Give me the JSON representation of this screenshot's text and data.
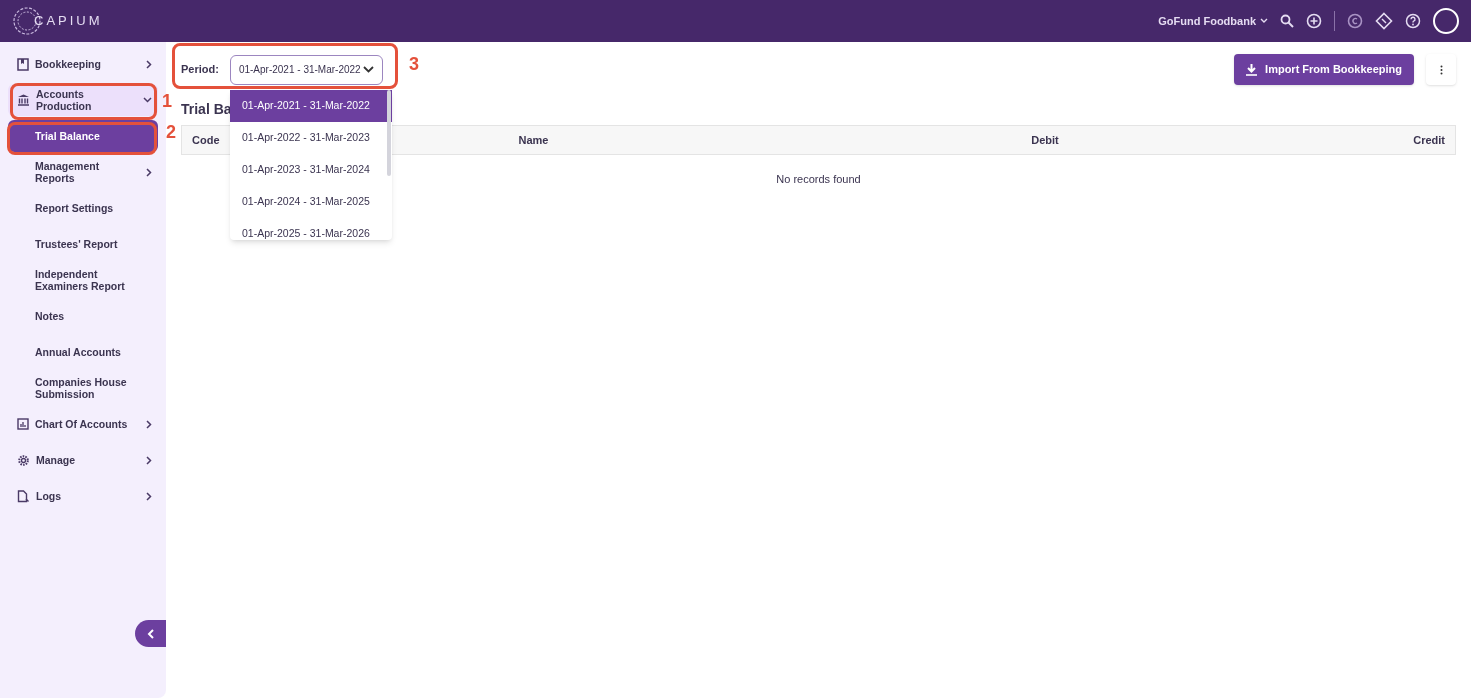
{
  "header": {
    "logo": "CAPIUM",
    "organisation": "GoFund Foodbank"
  },
  "sidebar": {
    "items": [
      {
        "label": "Bookkeeping",
        "kind": "group",
        "expanded": false,
        "selected": false
      },
      {
        "label": "Accounts Production",
        "kind": "group",
        "expanded": true,
        "selected": false,
        "children": [
          {
            "label": "Trial Balance",
            "kind": "link",
            "selected": true
          },
          {
            "label": "Management Reports",
            "kind": "group",
            "selected": false
          },
          {
            "label": "Report Settings",
            "kind": "link",
            "selected": false
          },
          {
            "label": "Trustees' Report",
            "kind": "link",
            "selected": false
          },
          {
            "label": "Independent Examiners Report",
            "kind": "link",
            "selected": false
          },
          {
            "label": "Notes",
            "kind": "link",
            "selected": false
          },
          {
            "label": "Annual Accounts",
            "kind": "link",
            "selected": false
          },
          {
            "label": "Companies House Submission",
            "kind": "link",
            "selected": false
          }
        ]
      },
      {
        "label": "Chart Of Accounts",
        "kind": "group",
        "expanded": false,
        "selected": false
      },
      {
        "label": "Manage",
        "kind": "group",
        "expanded": false,
        "selected": false
      },
      {
        "label": "Logs",
        "kind": "group",
        "expanded": false,
        "selected": false
      }
    ]
  },
  "period": {
    "label": "Period:",
    "value": "01-Apr-2021 - 31-Mar-2022",
    "options": [
      {
        "label": "01-Apr-2021 - 31-Mar-2022",
        "selected": true
      },
      {
        "label": "01-Apr-2022 - 31-Mar-2023",
        "selected": false
      },
      {
        "label": "01-Apr-2023 - 31-Mar-2024",
        "selected": false
      },
      {
        "label": "01-Apr-2024 - 31-Mar-2025",
        "selected": false
      },
      {
        "label": "01-Apr-2025 - 31-Mar-2026",
        "selected": false
      }
    ]
  },
  "import_button": "Import From Bookkeeping",
  "page_title": "Trial Ba",
  "table": {
    "columns": [
      "Code",
      "Name",
      "Debit",
      "Credit"
    ],
    "empty_message": "No records found"
  },
  "annotations": [
    "1",
    "2",
    "3"
  ]
}
